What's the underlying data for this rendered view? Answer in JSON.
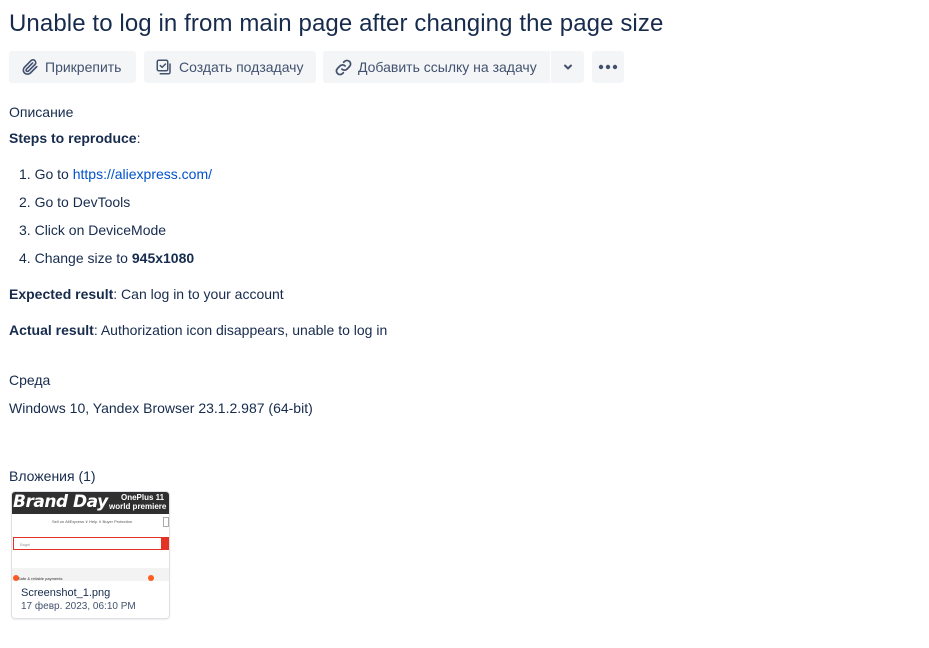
{
  "issue": {
    "title": "Unable to log in from main page after changing the page size"
  },
  "toolbar": {
    "attach_label": "Прикрепить",
    "subtask_label": "Создать подзадачу",
    "link_label": "Добавить ссылку на задачу"
  },
  "description": {
    "label": "Описание",
    "steps_heading": "Steps to reproduce",
    "steps_colon": ":",
    "steps": [
      {
        "num": "1.",
        "prefix": "Go to ",
        "link": "https://aliexpress.com/"
      },
      {
        "num": "2.",
        "text": "Go to DevTools"
      },
      {
        "num": "3.",
        "text": "Click on DeviceMode"
      },
      {
        "num": "4.",
        "prefix": "Change size to ",
        "bold": "945x1080"
      }
    ],
    "expected_label": "Expected result",
    "expected_text": ": Can log in to your account",
    "actual_label": "Actual result",
    "actual_text": ": Authorization icon disappears, unable to log in"
  },
  "environment": {
    "label": "Среда",
    "text": "Windows 10, Yandex Browser 23.1.2.987 (64-bit)"
  },
  "attachments": {
    "label": "Вложения (1)",
    "items": [
      {
        "name": "Screenshot_1.png",
        "date": "17 февр. 2023, 06:10 PM",
        "thumb": {
          "brand": "Brand Day",
          "promo_line1": "OnePlus 11",
          "promo_line2": "world premiere",
          "nav": "Sell on AliExpress ∨    Help ∨    Buyer Protection",
          "search_placeholder": "Bagel",
          "footer": "Safe & reliable payments"
        }
      }
    ]
  },
  "colors": {
    "link": "#0052cc",
    "text": "#172b4d",
    "button_bg": "#f4f5f7",
    "icon": "#42526e"
  },
  "icons": {
    "attach": "paperclip-icon",
    "subtask": "subtask-checkbox-icon",
    "link": "link-chain-icon",
    "chevron": "chevron-down-icon",
    "more": "more-dots-icon"
  }
}
